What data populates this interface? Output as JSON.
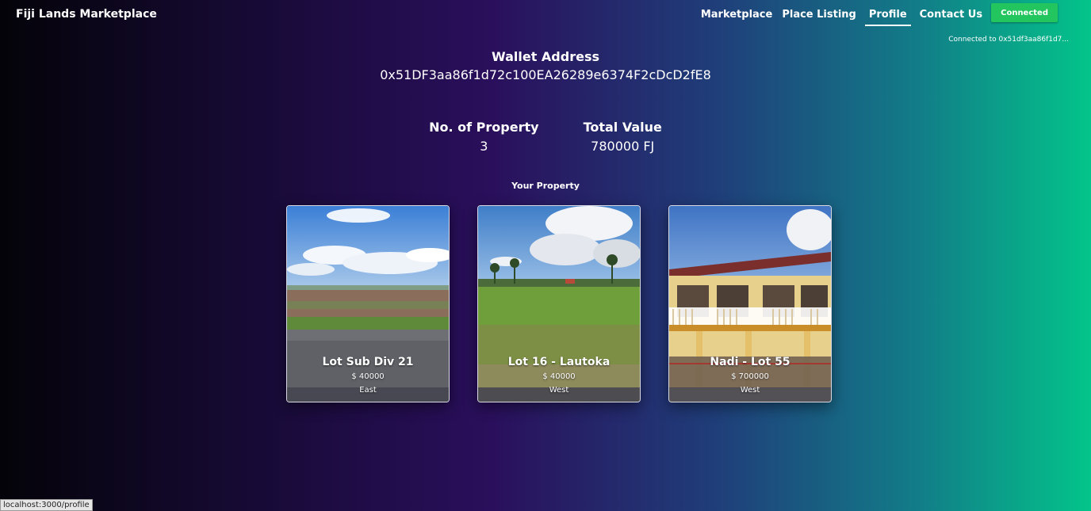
{
  "header": {
    "brand": "Fiji Lands Marketplace",
    "nav": [
      "Marketplace",
      "Place Listing",
      "Profile",
      "Contact Us"
    ],
    "active_nav": "Profile",
    "connect_label": "Connected",
    "connected_to": "Connected to 0x51df3aa86f1d7..."
  },
  "wallet": {
    "title": "Wallet Address",
    "address": "0x51DF3aa86f1d72c100EA26289e6374F2cDcD2fE8"
  },
  "stats": {
    "count_label": "No. of Property",
    "count_value": "3",
    "value_label": "Total Value",
    "value_value": "780000 FJ"
  },
  "section_title": "Your Property",
  "properties": [
    {
      "name": "Lot Sub Div 21",
      "price": "$ 40000",
      "region": "East"
    },
    {
      "name": "Lot 16 - Lautoka",
      "price": "$ 40000",
      "region": "West"
    },
    {
      "name": "Nadi - Lot 55",
      "price": "$ 700000",
      "region": "West"
    }
  ],
  "status_bar": {
    "url": "localhost:3000/profile"
  },
  "colors": {
    "connected_button": "#22c55e",
    "background_left": "#040309",
    "background_mid": "#2a0f5c",
    "background_right": "#03c48a"
  }
}
